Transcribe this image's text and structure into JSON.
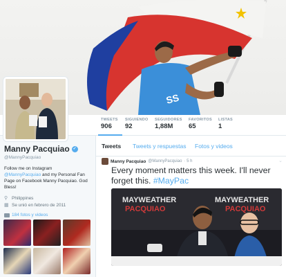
{
  "stats": [
    {
      "label": "TWEETS",
      "value": "906"
    },
    {
      "label": "SIGUIENDO",
      "value": "92"
    },
    {
      "label": "SEGUIDORES",
      "value": "1,88M"
    },
    {
      "label": "FAVORITOS",
      "value": "65"
    },
    {
      "label": "LISTAS",
      "value": "1"
    }
  ],
  "profile": {
    "name": "Manny Pacquiao",
    "handle": "@MannyPacquiao",
    "bio_line1": "Follow me on Instagram",
    "bio_link1": "@MannyPacquiao",
    "bio_mid": " and my Personal Fan Page on Facebook Manny Pacquiao. God Bless!",
    "location": "Philippines",
    "joined": "Se unió en febrero de 2011",
    "photos_link": "184 fotos y videos"
  },
  "tabs": [
    "Tweets",
    "Tweets y respuestas",
    "Fotos y videos"
  ],
  "tweet": {
    "author": "Manny Pacquiao",
    "handle": "@MannyPacquiao",
    "time": "· 5 h",
    "text": "Every moment matters this week. I'll never forget this. ",
    "hashtag": "#MayPac",
    "banner_words": [
      "MAYWEATHER",
      "PACQUIAO",
      "MAYWEATHER",
      "PACQUIAO"
    ]
  },
  "colors": {
    "accent": "#55acee",
    "text": "#292f33",
    "muted": "#8899a6"
  },
  "icons": [
    "verified-badge-icon",
    "location-pin-icon",
    "calendar-icon",
    "camera-icon",
    "caret-down-icon"
  ]
}
